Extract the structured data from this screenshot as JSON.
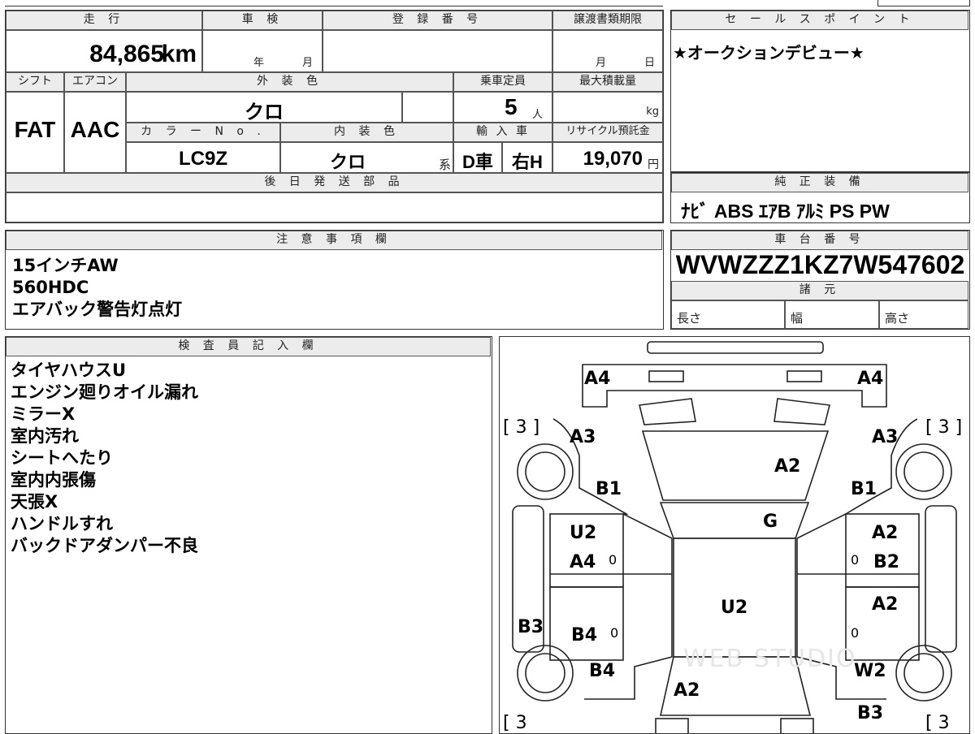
{
  "sheet": {
    "mileage": {
      "label": "走 行",
      "value": "84,865",
      "unit": "km"
    },
    "inspection": {
      "label": "車 検",
      "year_unit": "年",
      "month_unit": "月"
    },
    "registration": {
      "label": "登 録 番 号",
      "value": ""
    },
    "transfer_deadline": {
      "label": "譲渡書類期限",
      "month_unit": "月",
      "day_unit": "日"
    },
    "shift": {
      "label": "シフト",
      "value": "FAT"
    },
    "aircon": {
      "label": "エアコン",
      "value": "AAC"
    },
    "exterior_color": {
      "label": "外 装 色",
      "value": "クロ"
    },
    "capacity": {
      "label": "乗車定員",
      "value": "5",
      "unit": "人"
    },
    "max_load": {
      "label": "最大積載量",
      "value": "",
      "unit": "kg"
    },
    "color_no": {
      "label": "カ ラ ー N o .",
      "value": "LC9Z"
    },
    "interior_color": {
      "label": "内 装 色",
      "value": "クロ",
      "suffix": "系"
    },
    "import": {
      "label": "輸 入 車",
      "origin": "D車",
      "handle": "右H"
    },
    "recycle": {
      "label": "リサイクル預託金",
      "value": "19,070",
      "unit": "円"
    },
    "later_parts": {
      "label": "後 日 発 送 部 品",
      "value": ""
    }
  },
  "sales_point": {
    "label": "セ ー ル ス ポ イ ン ト",
    "text": "★オークションデビュー★"
  },
  "equipment": {
    "label": "純 正 装 備",
    "text": "ﾅﾋﾞ ABS ｴｱB ｱﾙﾐ PS PW"
  },
  "notes": {
    "label": "注 意 事 項 欄",
    "lines": [
      "15インチAW",
      "560HDC",
      "エアバック警告灯点灯"
    ]
  },
  "chassis": {
    "label": "車 台 番 号",
    "value": "WVWZZZ1KZ7W547602"
  },
  "specs": {
    "label": "諸 元",
    "length": "長さ",
    "width": "幅",
    "height": "高さ"
  },
  "inspector": {
    "label": "検 査 員 記 入 欄",
    "lines": [
      "タイヤハウスU",
      "エンジン廻りオイル漏れ",
      "ミラーX",
      "室内汚れ",
      "シートへたり",
      "室内内張傷",
      "天張X",
      "ハンドルすれ",
      "バックドアダンパー不良"
    ]
  },
  "diagram": {
    "tire_tl": "[ 3 ]",
    "tire_tr": "[ 3 ]",
    "tire_bl": "[ 3",
    "tire_br": "[ 3",
    "marks": {
      "front_left": "A4",
      "front_right": "A4",
      "fender_fl": "A3",
      "fender_fr": "A3",
      "bonnet": "A2",
      "bonnet_sub_l": "B1",
      "bonnet_sub_r": "B1",
      "windshield": "G",
      "door_fl_1": "U2",
      "door_fl_2": "A4",
      "door_fr_1": "A2",
      "door_fr_2": "B2",
      "roof": "U2",
      "door_rr_1": "A2",
      "side_l": "B3",
      "door_rl": "B4",
      "rear_l": "B4",
      "rear_r": "W2",
      "trunk": "A2",
      "rear_b": "B3"
    },
    "zero": "0",
    "watermark": "WEB STUDIO"
  }
}
